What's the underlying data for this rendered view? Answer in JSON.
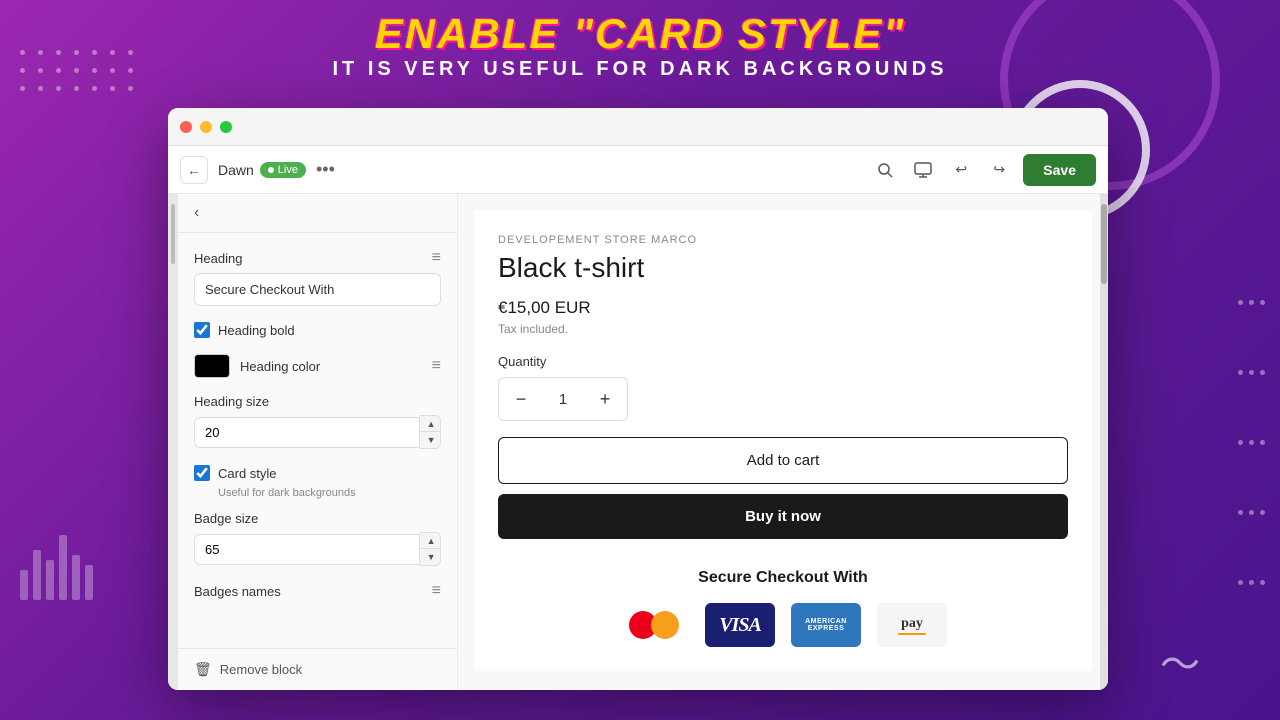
{
  "background": {
    "gradient_start": "#9C27B0",
    "gradient_end": "#4A148C"
  },
  "header": {
    "line1": "Enable \"Card style\"",
    "line2": "It is very useful for dark backgrounds"
  },
  "browser": {
    "title": "Dawn",
    "live_label": "Live",
    "more_icon": "•••",
    "save_label": "Save",
    "undo_icon": "↩",
    "redo_icon": "↪"
  },
  "sidebar": {
    "back_label": "‹",
    "heading_label": "Heading",
    "heading_value": "Secure Checkout With",
    "heading_bold_label": "Heading bold",
    "heading_bold_checked": true,
    "heading_color_label": "Heading color",
    "heading_size_label": "Heading size",
    "heading_size_value": "20",
    "card_style_label": "Card style",
    "card_style_checked": true,
    "card_style_sub": "Useful for dark backgrounds",
    "badge_size_label": "Badge size",
    "badge_size_value": "65",
    "badges_names_label": "Badges names",
    "remove_block_label": "Remove block"
  },
  "product": {
    "store_name": "DEVELOPEMENT STORE MARCO",
    "title": "Black t-shirt",
    "price": "€15,00 EUR",
    "tax_note": "Tax included.",
    "quantity_label": "Quantity",
    "quantity_value": "1",
    "add_to_cart_label": "Add to cart",
    "buy_now_label": "Buy it now",
    "secure_checkout_title": "Secure Checkout With"
  },
  "payment_badges": [
    {
      "name": "mastercard",
      "label": "Mastercard"
    },
    {
      "name": "visa",
      "label": "VISA"
    },
    {
      "name": "amex",
      "label": "AMERICAN EXPRESS"
    },
    {
      "name": "amazon-pay",
      "label": "pay"
    }
  ]
}
